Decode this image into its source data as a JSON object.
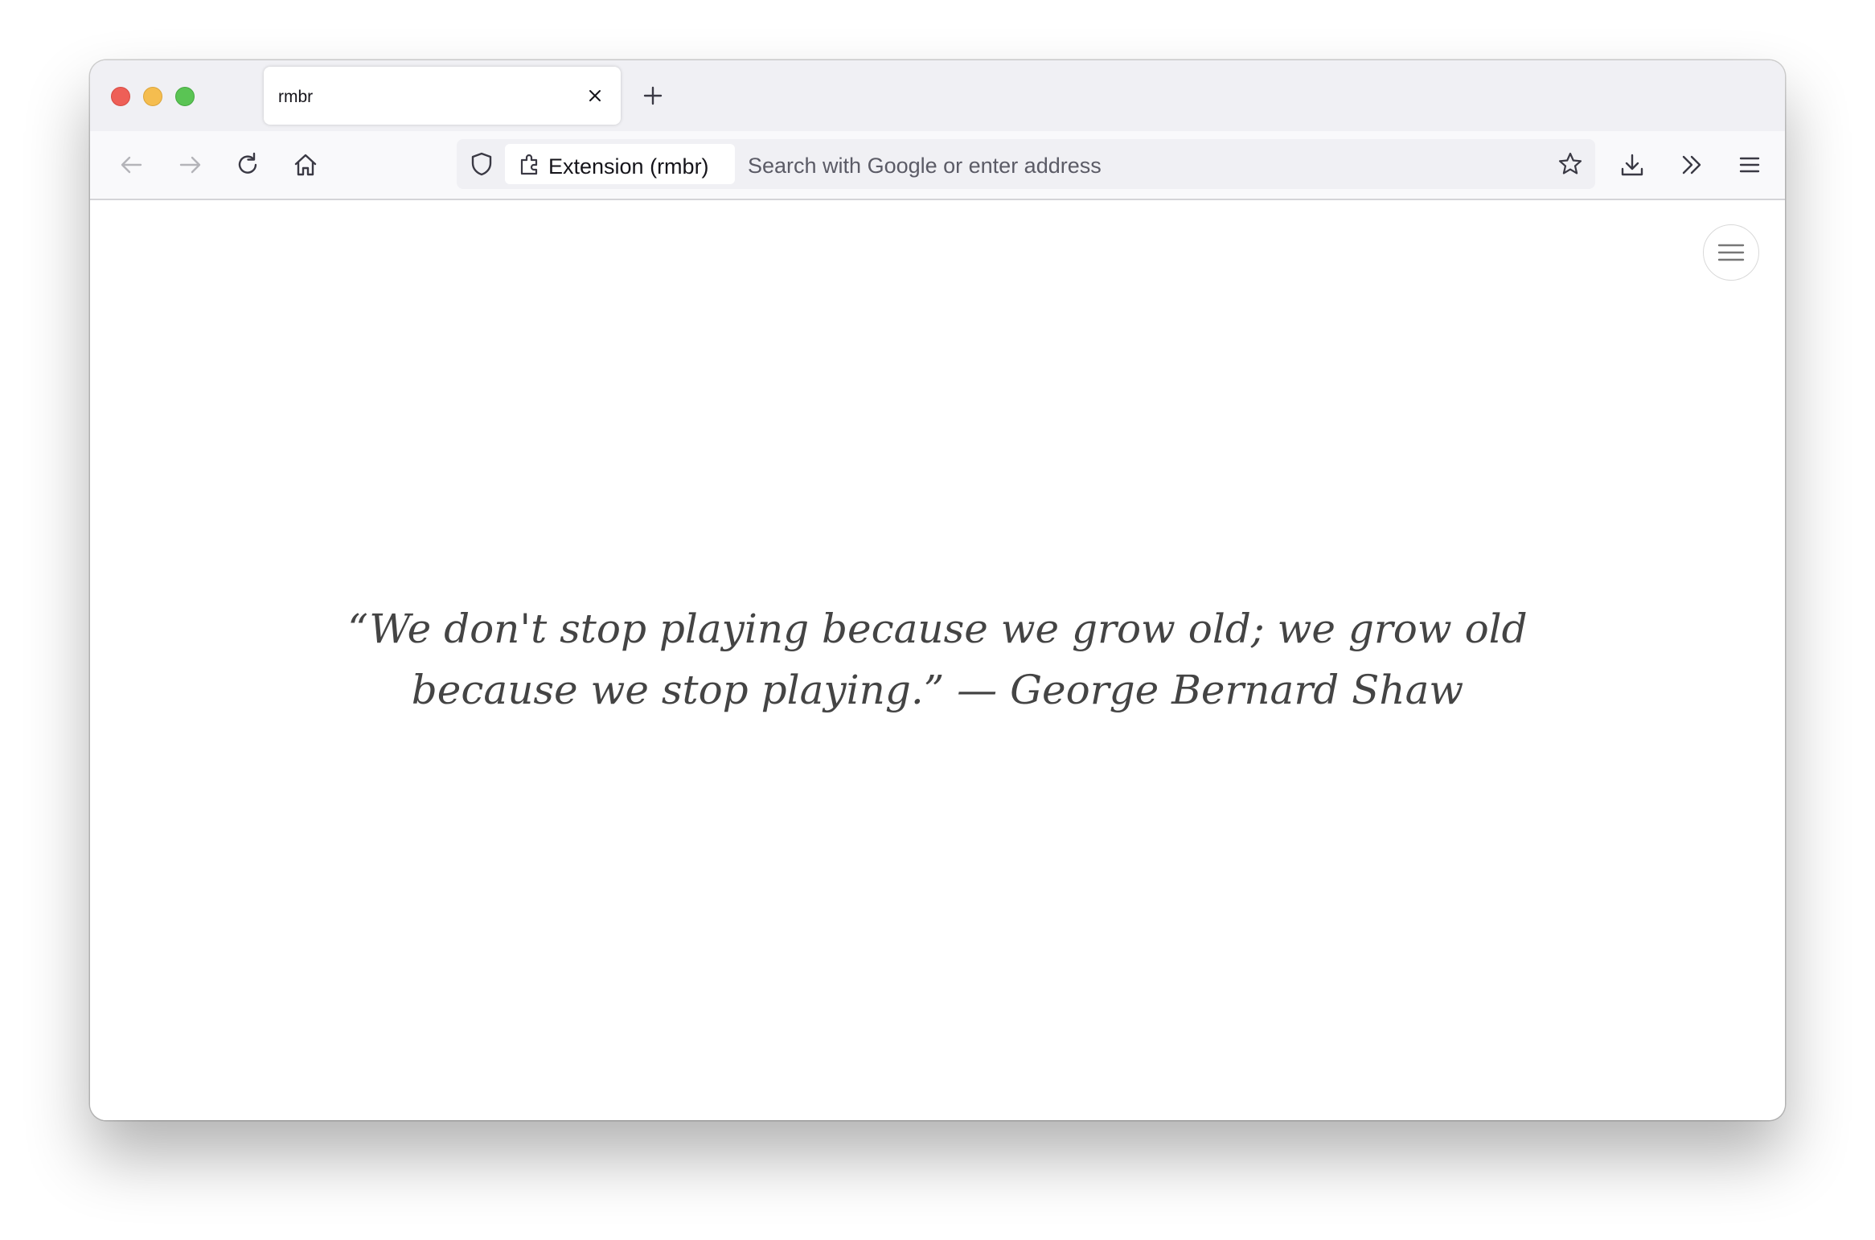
{
  "window": {
    "traffic_lights": [
      "close",
      "minimize",
      "zoom"
    ]
  },
  "tabs": [
    {
      "title": "rmbr",
      "active": true
    }
  ],
  "toolbar": {
    "back_icon": "arrow-left-icon",
    "forward_icon": "arrow-right-icon",
    "reload_icon": "reload-icon",
    "home_icon": "home-icon",
    "downloads_icon": "download-icon",
    "overflow_icon": "chevron-double-right-icon",
    "menu_icon": "hamburger-icon"
  },
  "urlbar": {
    "identity_label": "Extension (rmbr)",
    "placeholder": "Search with Google or enter address"
  },
  "page": {
    "quote_text": "“We don't stop playing because we grow old; we grow old because we stop playing.” — George Bernard Shaw",
    "menu_icon": "hamburger-icon"
  },
  "colors": {
    "tabstrip_bg": "#f0f0f4",
    "navbar_bg": "#f9f9fb",
    "quote_color": "#444444",
    "close_red": "#ee5f57",
    "minimize_yellow": "#f5bd4f",
    "zoom_green": "#5ac454"
  }
}
